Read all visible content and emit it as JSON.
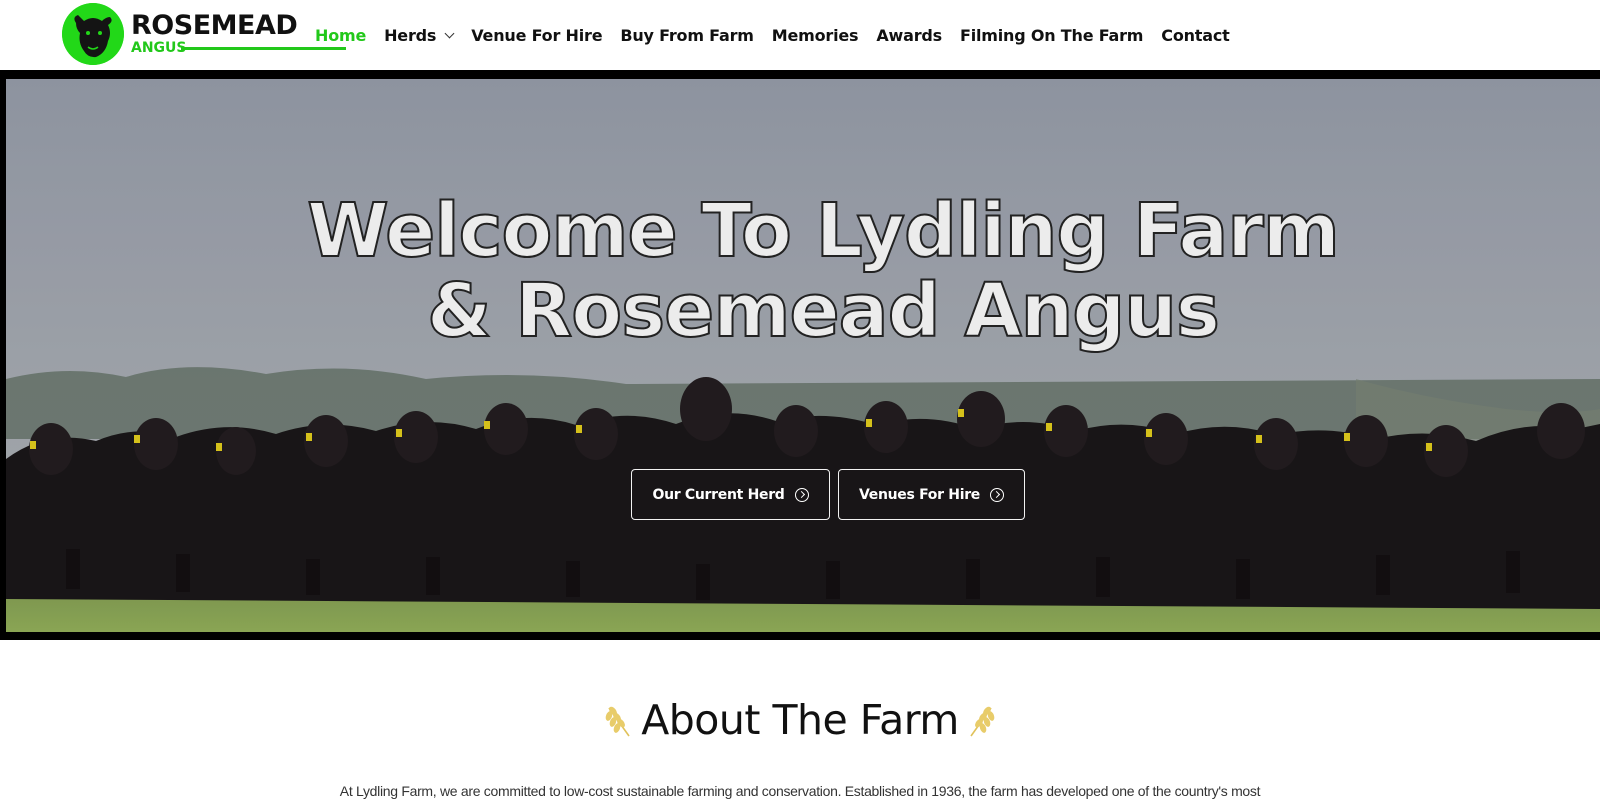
{
  "brand": {
    "name": "ROSEMEAD",
    "sub": "ANGUS",
    "accent": "#22c81a"
  },
  "nav": {
    "items": [
      {
        "label": "Home",
        "active": true
      },
      {
        "label": "Herds",
        "has_dropdown": true
      },
      {
        "label": "Venue For Hire"
      },
      {
        "label": "Buy From Farm"
      },
      {
        "label": "Memories"
      },
      {
        "label": "Awards"
      },
      {
        "label": "Filming On The Farm"
      },
      {
        "label": "Contact"
      }
    ]
  },
  "hero": {
    "title": "Welcome To Lydling Farm & Rosemead Angus",
    "buttons": [
      {
        "label": "Our Current Herd",
        "icon": "arrow-circle-right-icon"
      },
      {
        "label": "Venues For Hire",
        "icon": "arrow-circle-right-icon"
      }
    ]
  },
  "about": {
    "title": "About The Farm",
    "text": "At Lydling Farm, we are committed to low-cost sustainable farming and conservation. Established in 1936, the farm has developed one of the country's most"
  }
}
